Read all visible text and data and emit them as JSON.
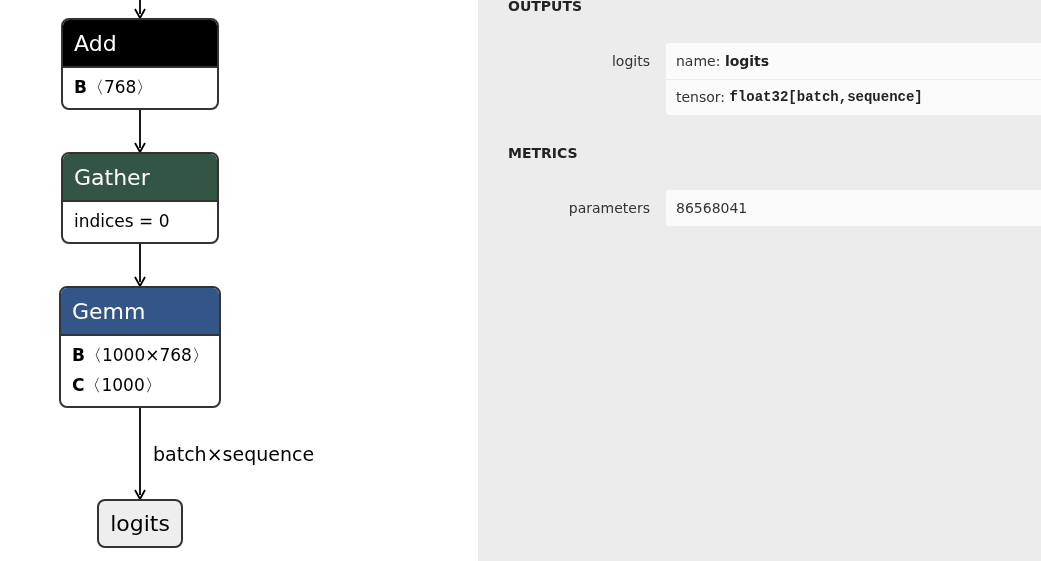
{
  "graph": {
    "nodes": [
      {
        "title": "Add",
        "color": "#000000",
        "attributes": [
          "**B**〈768〉"
        ]
      },
      {
        "title": "Gather",
        "color": "#335544",
        "attributes": [
          "indices = 0"
        ]
      },
      {
        "title": "Gemm",
        "color": "#335588",
        "attributes": [
          "**B**〈1000×768〉",
          "**C**〈1000〉"
        ]
      }
    ],
    "output_edge_label": "batch×sequence",
    "output": {
      "name": "logits"
    }
  },
  "panel": {
    "sections": [
      {
        "title": "OUTPUTS",
        "properties": [
          {
            "label": "logits",
            "lines": [
              {
                "kind": "bold",
                "key": "name:",
                "value": "logits"
              },
              {
                "kind": "code",
                "key": "tensor:",
                "value": "float32[batch,sequence]"
              }
            ]
          }
        ]
      },
      {
        "title": "METRICS",
        "properties": [
          {
            "label": "parameters",
            "lines": [
              {
                "kind": "plain",
                "value": "86568041"
              }
            ]
          }
        ]
      }
    ]
  }
}
